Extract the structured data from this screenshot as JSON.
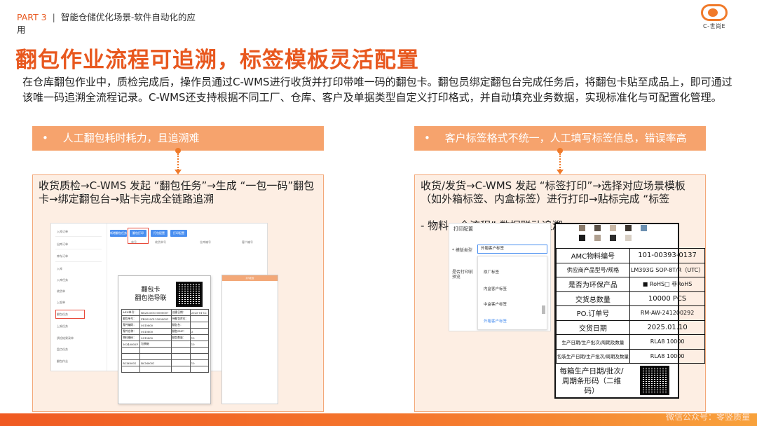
{
  "header": {
    "part_code": "PART 3",
    "divider": "|",
    "part_title": "智能仓储优化场景-软件自动化的应用"
  },
  "logo": {
    "text": "C-世尚E"
  },
  "title": "翻包作业流程可追溯，标签模板灵活配置",
  "intro": "在仓库翻包作业中，质检完成后，操作员通过C-WMS进行收货并打印带唯一码的翻包卡。翻包员绑定翻包台完成任务后，将翻包卡贴至成品上，即可通过该唯一码追溯全流程记录。C-WMS还支持根据不同工厂、仓库、客户及单据类型自定义打印格式，并自动填充业务数据，实现标准化与可配置化管理。",
  "left": {
    "pain": {
      "bullet": "•",
      "text": "人工翻包耗时耗力，且追溯难"
    },
    "solution": "收货质检→C-WMS 发起 “翻包任务”→生成 “一包一码”翻包卡→绑定翻包台→贴卡完成全链路追溯",
    "wms_screen": {
      "nav": [
        "入库订单",
        "出库订单",
        "库存订单",
        "入库",
        "入库任务",
        "收货单",
        "上架单",
        "翻包任务",
        "上架任务",
        "质检结果录单",
        "盘点任务",
        "翻包作业"
      ],
      "buttons": [
        "新增翻包任务",
        "翻包打印",
        "打包配置",
        "打印配置"
      ],
      "columns": [
        "单号",
        "收货单号",
        "仓库编号",
        "客户编号"
      ]
    },
    "pack_card": {
      "title_line1": "翻包卡",
      "title_line2": "翻包指导联",
      "rows": [
        [
          "ASN单号：",
          "RS20250110000007",
          "创建日期：",
          "2025-01-12"
        ],
        [
          "翻包单号：",
          "FB20250110000001",
          "待翻包库位：",
          ""
        ],
        [
          "零件编码：",
          "0010800",
          "翻包台：",
          ""
        ],
        [
          "零件名称：",
          "0010800",
          "翻包SNP：",
          "3"
        ],
        [
          "物料编码：",
          "0010800",
          "翻包数量：",
          "10"
        ],
        [
          "30340805P",
          "包装箱",
          "",
          "10"
        ],
        [
          "",
          "",
          "",
          ""
        ],
        [
          "",
          "",
          "",
          ""
        ],
        [
          "BCM0001",
          "BCM0001",
          "",
          "10"
        ],
        [
          "",
          "",
          "",
          ""
        ]
      ]
    },
    "popup": {
      "title": "打印配置"
    }
  },
  "right": {
    "pain": {
      "bullet": "•",
      "text": "客户标签格式不统一，人工填写标签信息，错误率高"
    },
    "solution": "收货/发货→C-WMS 发起 “标签打印”→选择对应场景模板（如外箱标签、内盒标签）进行打印→贴标完成 “标签",
    "solution_tail": "- 物料—全流程” 数据联动追溯",
    "print_dialog": {
      "title": "打印配置",
      "scene_label": "* 模版类型",
      "scene_value": "外箱客户标签",
      "default_label": "是否打印前预览",
      "options": [
        "原厂标签",
        "内盒客户标签",
        "中盒客户标签",
        "外箱客户标签"
      ],
      "active_option": "外箱客户标签"
    },
    "label_card": {
      "swatch_colors": [
        "#8b7b6b",
        "#5c5248",
        "#c9b8a6",
        "#3d3630",
        "#6b8fb0",
        "#1a1a1a",
        "#b0a090",
        "#2b2b2b",
        "#d8cfc4"
      ],
      "rows": [
        [
          "AMC物料编号",
          "101-00393-0137"
        ],
        [
          "供应商产品型号/规格",
          "LM393G  SOP-8T/R（UTC）"
        ],
        [
          "是否为环保产品",
          "■ RoHS□ 非RoHS"
        ],
        [
          "交货总数量",
          "10000  PCS"
        ],
        [
          "PO.订单号",
          "RM-AW-241200292"
        ],
        [
          "交货日期",
          "2025.01.10"
        ],
        [
          "生产日期/生产批次/周期及数量",
          "RLA8        10000"
        ],
        [
          "包装生产日期/生产批次/周期及数量",
          "RLA8        10000"
        ]
      ],
      "bottom_text": "每箱生产日期/批次/周期条形码（二维码）"
    }
  },
  "watermark": "微信公众号：零竖质量"
}
